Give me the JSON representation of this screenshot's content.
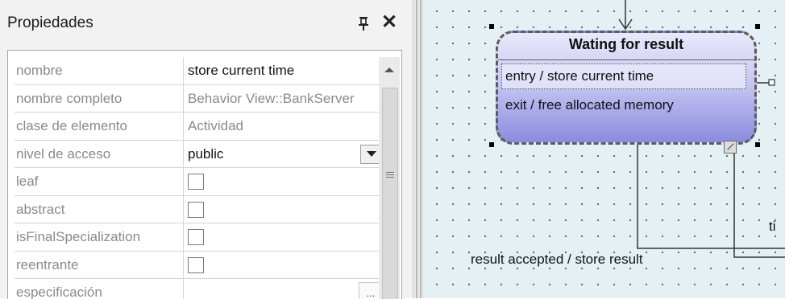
{
  "properties_panel": {
    "title": "Propiedades",
    "pin_icon": "pin-icon",
    "close_glyph": "✕",
    "rows": [
      {
        "name": "nombre",
        "value": "store current time",
        "type": "text"
      },
      {
        "name": "nombre completo",
        "value": "Behavior View::BankServer",
        "type": "readonly"
      },
      {
        "name": "clase de elemento",
        "value": "Actividad",
        "type": "readonly"
      },
      {
        "name": "nivel de acceso",
        "value": "public",
        "type": "dropdown"
      },
      {
        "name": "leaf",
        "value": "",
        "type": "checkbox",
        "checked": false
      },
      {
        "name": "abstract",
        "value": "",
        "type": "checkbox",
        "checked": false
      },
      {
        "name": "isFinalSpecialization",
        "value": "",
        "type": "checkbox",
        "checked": false
      },
      {
        "name": "reentrante",
        "value": "",
        "type": "checkbox",
        "checked": false
      },
      {
        "name": "especificación",
        "value": "",
        "type": "ellipsis",
        "button_label": "..."
      }
    ]
  },
  "diagram": {
    "state": {
      "title": "Wating for result",
      "entry_action": "entry / store current time",
      "exit_action": "exit / free allocated memory"
    },
    "transitions": {
      "result_label": "result accepted / store result",
      "partial_label": "ti"
    },
    "colors": {
      "canvas_bg": "#e4f0f4",
      "state_gradient_top": "#e9e9fb",
      "state_gradient_bottom": "#8b8be0"
    }
  }
}
